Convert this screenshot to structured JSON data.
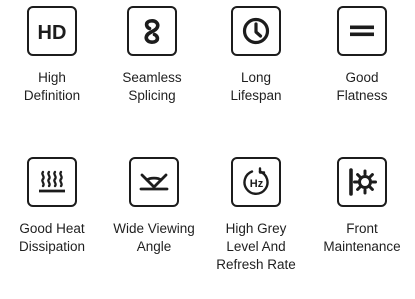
{
  "features": [
    {
      "icon": "hd-icon",
      "lines": [
        "High",
        "Definition"
      ]
    },
    {
      "icon": "seamless-splicing-icon",
      "lines": [
        "Seamless",
        "Splicing"
      ]
    },
    {
      "icon": "clock-icon",
      "lines": [
        "Long",
        "Lifespan"
      ]
    },
    {
      "icon": "flatness-icon",
      "lines": [
        "Good",
        "Flatness"
      ]
    },
    {
      "icon": "heat-icon",
      "lines": [
        "Good Heat",
        "Dissipation"
      ]
    },
    {
      "icon": "viewing-angle-icon",
      "lines": [
        "Wide Viewing",
        "Angle"
      ]
    },
    {
      "icon": "refresh-rate-icon",
      "lines": [
        "High Grey",
        "Level And",
        "Refresh Rate"
      ]
    },
    {
      "icon": "front-maintenance-icon",
      "lines": [
        "Front",
        "Maintenance"
      ]
    }
  ],
  "icon_text": {
    "hd": "HD",
    "hz": "Hz"
  },
  "colors": {
    "icon_stroke": "#1c1c1c",
    "text": "#1f1f1f",
    "background": "#ffffff"
  }
}
